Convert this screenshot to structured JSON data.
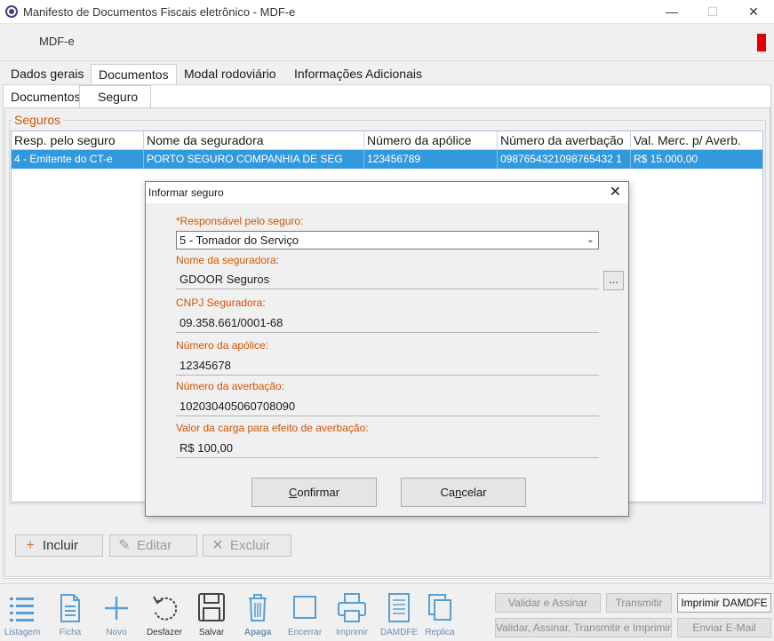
{
  "window": {
    "title": "Manifesto de Documentos Fiscais eletrônico - MDF-e",
    "minimize": "—",
    "maximize": "☐",
    "close": "✕"
  },
  "header": {
    "label": "MDF-e",
    "indicator_color": "#e00000"
  },
  "tabs": [
    "Dados gerais",
    "Documentos",
    "Modal rodoviário",
    "Informações Adicionais"
  ],
  "subtabs": [
    "Documentos",
    "Seguro"
  ],
  "seguros": {
    "group_title": "Seguros",
    "columns": [
      "Resp. pelo seguro",
      "Nome da seguradora",
      "Número da apólice",
      "Número da averbação",
      "Val. Merc. p/ Averb."
    ],
    "rows": [
      [
        "4 - Emitente do CT-e",
        "PORTO SEGURO COMPANHIA DE SEG",
        "123456789",
        "0987654321098765432 1",
        "R$ 15.000,00"
      ]
    ]
  },
  "actions": {
    "incluir": "Incluir",
    "editar": "Editar",
    "excluir": "Excluir"
  },
  "toolbar": {
    "listagem": "Listagem",
    "ficha": "Ficha",
    "novo": "Novo",
    "desfazer": "Desfazer",
    "salvar": "Salvar",
    "apaga": "Apaga",
    "encerrar": "Encerrar",
    "imprimir": "Imprimir",
    "damdfe": "DAMDFE",
    "replica": "Replica"
  },
  "side_buttons": {
    "validar_assinar": "Validar e Assinar",
    "transmitir": "Transmitir",
    "imprimir_damdfe": "Imprimir DAMDFE",
    "validar_assinar_transmitir_imprimir": "Validar, Assinar, Transmitir e Imprimir",
    "enviar_email": "Enviar E-Mail"
  },
  "dialog": {
    "title": "Informar seguro",
    "close": "✕",
    "responsavel_label": "*Responsável pelo seguro:",
    "responsavel_value": "5 - Tomador do Serviço",
    "seguradora_label": "Nome da seguradora:",
    "seguradora_value": "GDOOR Seguros",
    "ellipsis": "...",
    "cnpj_label": "CNPJ Seguradora:",
    "cnpj_value": "09.358.661/0001-68",
    "apolice_label": "Número da apólice:",
    "apolice_value": "12345678",
    "averbacao_label": "Número da averbação:",
    "averbacao_value": "102030405060708090",
    "valor_label": "Valor da carga para efeito de averbação:",
    "valor_value": "R$ 100,00",
    "confirmar_u": "C",
    "confirmar_rest": "onfirmar",
    "cancelar_pre": "Ca",
    "cancelar_u": "n",
    "cancelar_rest": "celar"
  }
}
